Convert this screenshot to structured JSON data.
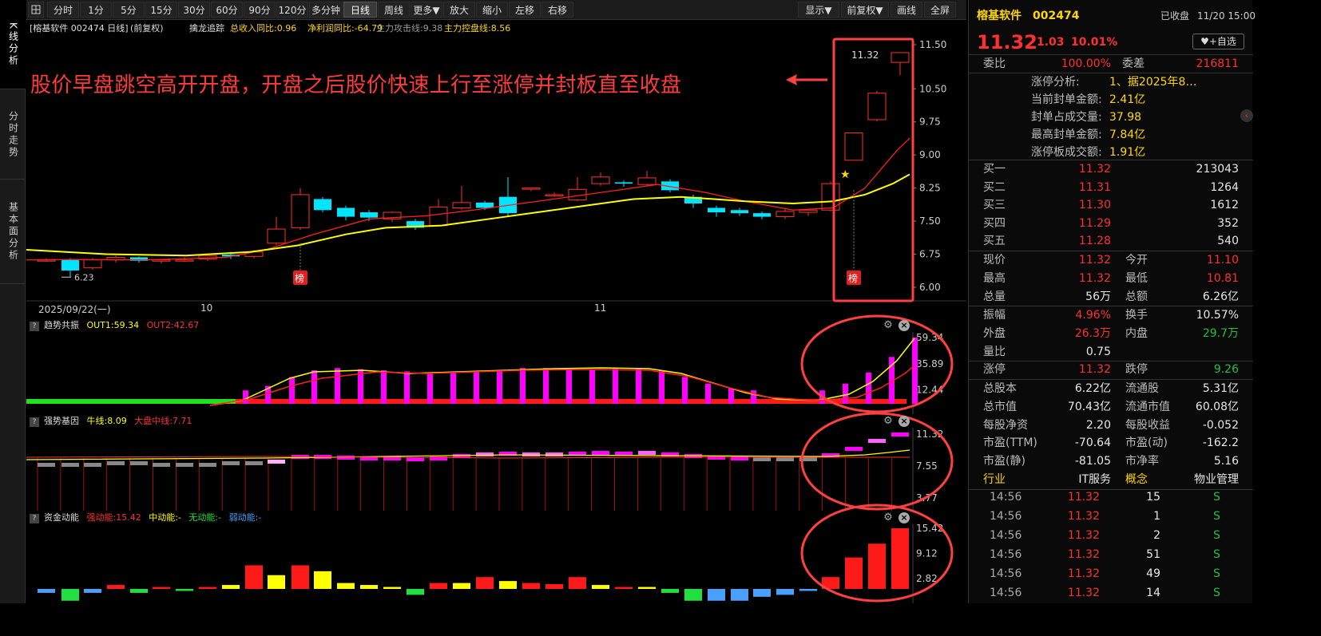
{
  "sidebar": {
    "tabs": [
      {
        "label": "K线分析"
      },
      {
        "label": "分时走势"
      },
      {
        "label": "基本面分析"
      }
    ]
  },
  "toolbar": {
    "periods": [
      "分时",
      "1分",
      "5分",
      "15分",
      "30分",
      "60分",
      "90分",
      "120分",
      "多分钟",
      "日线",
      "周线",
      "更多▼",
      "放大",
      "缩小",
      "左移",
      "右移"
    ],
    "selected": "日线",
    "right": [
      "显示▼",
      "前复权▼",
      "画线",
      "全屏"
    ]
  },
  "infobar": {
    "title": "[榕基软件 002474 日线]",
    "adjust": "(前复权)",
    "indicator": "擒龙追踪",
    "revenue": "总收入同比:0.96",
    "profit": "净利润同比:-64.79",
    "attack": "主力攻击线:9.38",
    "control": "主力控盘线:8.56"
  },
  "annotation": "股价早盘跳空高开开盘，开盘之后股价快速上行至涨停并封板直至收盘",
  "main_axis": {
    "ticks": [
      "11.50",
      "10.50",
      "9.75",
      "9.00",
      "8.25",
      "7.50",
      "6.75",
      "6.00"
    ],
    "last_price": "11.32",
    "low_label": "6.23",
    "bang": "榜"
  },
  "date_axis": {
    "start": "2025/09/22(一)",
    "m10": "10",
    "m11": "11"
  },
  "panels": {
    "trend": {
      "name": "趋势共振",
      "out1": "OUT1:59.34",
      "out2": "OUT2:42.67",
      "ticks": [
        "59.34",
        "35.89",
        "12.44"
      ]
    },
    "gene": {
      "name": "强势基因",
      "bull": "牛线:8.09",
      "market": "大盘中线:7.71",
      "ticks": [
        "11.32",
        "7.55",
        "3.77"
      ]
    },
    "fund": {
      "name": "资金动能",
      "strong": "强动能:15.42",
      "mid": "中动能:-",
      "none": "无动能:-",
      "weak": "弱动能:-",
      "ticks": [
        "15.42",
        "9.12",
        "2.82"
      ]
    }
  },
  "stock": {
    "name": "榕基软件",
    "code": "002474",
    "status": "已收盘",
    "time": "11/20 15:00",
    "price": "11.32",
    "change": "1.03",
    "pct": "10.01%",
    "watch": "+自选"
  },
  "weibi": {
    "label": "委比",
    "value": "100.00%",
    "label2": "委差",
    "value2": "216811"
  },
  "limit": [
    {
      "label": "涨停分析:",
      "value": "1、据2025年8…"
    },
    {
      "label": "当前封单金额:",
      "value": "2.41亿"
    },
    {
      "label": "封单占成交量:",
      "value": "37.98"
    },
    {
      "label": "最高封单金额:",
      "value": "7.84亿"
    },
    {
      "label": "涨停板成交额:",
      "value": "1.91亿"
    }
  ],
  "orderbook": [
    {
      "label": "买一",
      "price": "11.32",
      "vol": "213043"
    },
    {
      "label": "买二",
      "price": "11.31",
      "vol": "1264"
    },
    {
      "label": "买三",
      "price": "11.30",
      "vol": "1612"
    },
    {
      "label": "买四",
      "price": "11.29",
      "vol": "352"
    },
    {
      "label": "买五",
      "price": "11.28",
      "vol": "540"
    }
  ],
  "quote": [
    {
      "l1": "现价",
      "v1": "11.32",
      "c1": "red",
      "l2": "今开",
      "v2": "11.10",
      "c2": "red"
    },
    {
      "l1": "最高",
      "v1": "11.32",
      "c1": "red",
      "l2": "最低",
      "v2": "10.81",
      "c2": "red"
    },
    {
      "l1": "总量",
      "v1": "56万",
      "c1": "white",
      "l2": "总额",
      "v2": "6.26亿",
      "c2": "white"
    }
  ],
  "stats": [
    {
      "l1": "振幅",
      "v1": "4.96%",
      "c1": "red",
      "l2": "换手",
      "v2": "10.57%",
      "c2": "white"
    },
    {
      "l1": "外盘",
      "v1": "26.3万",
      "c1": "red",
      "l2": "内盘",
      "v2": "29.7万",
      "c2": "green"
    },
    {
      "l1": "量比",
      "v1": "0.75",
      "c1": "white",
      "l2": "",
      "v2": "",
      "c2": "white"
    }
  ],
  "limits": {
    "l1": "涨停",
    "v1": "11.32",
    "l2": "跌停",
    "v2": "9.26"
  },
  "fundamentals": [
    {
      "l1": "总股本",
      "v1": "6.22亿",
      "l2": "流通股",
      "v2": "5.31亿"
    },
    {
      "l1": "总市值",
      "v1": "70.43亿",
      "l2": "流通市值",
      "v2": "60.08亿"
    },
    {
      "l1": "每股净资",
      "v1": "2.20",
      "l2": "每股收益",
      "v2": "-0.052"
    },
    {
      "l1": "市盈(TTM)",
      "v1": "-70.64",
      "l2": "市盈(动)",
      "v2": "-162.2"
    },
    {
      "l1": "市盈(静)",
      "v1": "-81.05",
      "l2": "市净率",
      "v2": "5.16"
    }
  ],
  "industry": {
    "l1": "行业",
    "v1": "IT服务",
    "l2": "概念",
    "v2": "物业管理"
  },
  "ticks": [
    {
      "time": "14:56",
      "price": "11.32",
      "vol": "15",
      "side": "S"
    },
    {
      "time": "14:56",
      "price": "11.32",
      "vol": "1",
      "side": "S"
    },
    {
      "time": "14:56",
      "price": "11.32",
      "vol": "2",
      "side": "S"
    },
    {
      "time": "14:56",
      "price": "11.32",
      "vol": "51",
      "side": "S"
    },
    {
      "time": "14:56",
      "price": "11.32",
      "vol": "49",
      "side": "S"
    },
    {
      "time": "14:56",
      "price": "11.32",
      "vol": "14",
      "side": "S"
    }
  ],
  "colors": {
    "up": "#ff3030",
    "down": "#00e5ff",
    "ma_fast": "#ff2020",
    "ma_slow": "#ffff00",
    "magenta": "#ff00ff",
    "annot": "#ff3b3b"
  }
}
